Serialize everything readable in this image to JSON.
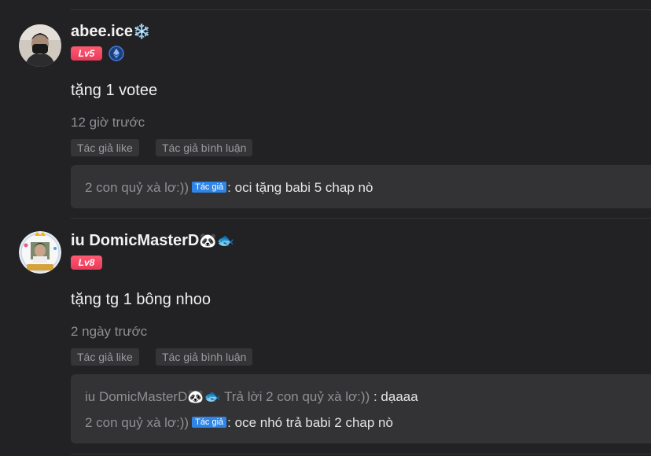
{
  "comments": [
    {
      "username": "abee.ice",
      "username_emoji": "❄️",
      "level": "Lv5",
      "verified_icon": "ethereum-diamond-icon",
      "text": "tặng 1 votee",
      "time": "12 giờ trước",
      "tags": [
        "Tác giả like",
        "Tác giả bình luận"
      ],
      "replies": [
        {
          "user": "2 con quỷ xà lơ:))",
          "badge": "Tác giả",
          "text": ": oci tặng babi 5 chap nò"
        }
      ]
    },
    {
      "username": "iu DomicMasterD",
      "username_emoji": "🐼🐟",
      "level": "Lv8",
      "text": "tặng tg 1 bông nhoo",
      "time": "2 ngày trước",
      "tags": [
        "Tác giả like",
        "Tác giả bình luận"
      ],
      "replies": [
        {
          "user": "iu DomicMasterD🐼🐟",
          "reply_to": "Trả lời 2 con quỷ xà lơ:))",
          "text": ": dạaaa"
        },
        {
          "user": "2 con quỷ xà lơ:))",
          "badge": "Tác giả",
          "text": ": oce nhó trả babi 2 chap nò"
        }
      ]
    }
  ],
  "colors": {
    "background": "#222224",
    "level_badge": "#ff5a73",
    "author_badge": "#2f86e8",
    "reply_box": "#333336"
  }
}
